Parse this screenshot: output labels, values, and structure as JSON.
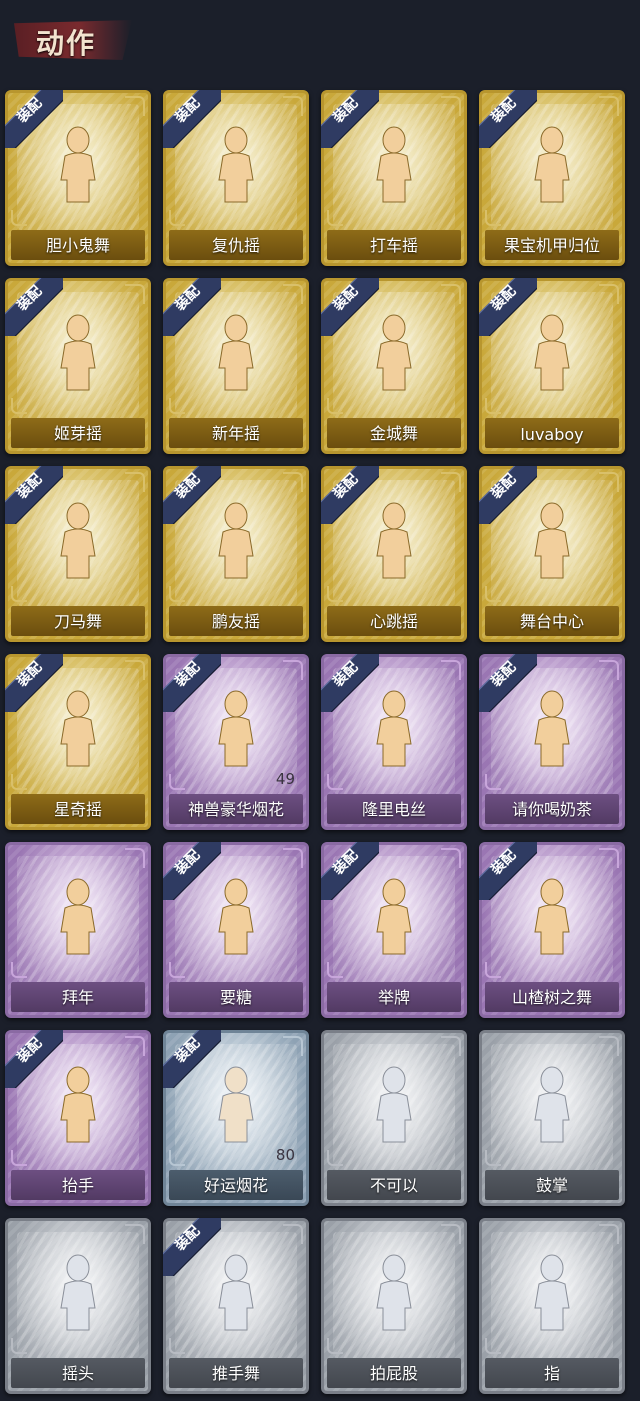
{
  "header": {
    "title": "动作"
  },
  "equip_label": "装配",
  "icons": [
    "figure-icon"
  ],
  "colors": {
    "gold": "#c9a83a",
    "purple": "#9a76b3",
    "blue": "#8ea2b4",
    "gray": "#9aa0a8",
    "equip_badge": "#2f3b62"
  },
  "cards": [
    {
      "name": "胆小鬼舞",
      "rarity": "gold",
      "equipped": true
    },
    {
      "name": "复仇摇",
      "rarity": "gold",
      "equipped": true
    },
    {
      "name": "打车摇",
      "rarity": "gold",
      "equipped": true
    },
    {
      "name": "果宝机甲归位",
      "rarity": "gold",
      "equipped": true
    },
    {
      "name": "姬芽摇",
      "rarity": "gold",
      "equipped": true
    },
    {
      "name": "新年摇",
      "rarity": "gold",
      "equipped": true
    },
    {
      "name": "金城舞",
      "rarity": "gold",
      "equipped": true
    },
    {
      "name": "luvaboy",
      "rarity": "gold",
      "equipped": true
    },
    {
      "name": "刀马舞",
      "rarity": "gold",
      "equipped": true
    },
    {
      "name": "鹏友摇",
      "rarity": "gold",
      "equipped": true
    },
    {
      "name": "心跳摇",
      "rarity": "gold",
      "equipped": true
    },
    {
      "name": "舞台中心",
      "rarity": "gold",
      "equipped": true
    },
    {
      "name": "星奇摇",
      "rarity": "gold",
      "equipped": true
    },
    {
      "name": "神兽豪华烟花",
      "rarity": "purple",
      "equipped": true,
      "count": "49"
    },
    {
      "name": "隆里电丝",
      "rarity": "purple",
      "equipped": true
    },
    {
      "name": "请你喝奶茶",
      "rarity": "purple",
      "equipped": true
    },
    {
      "name": "拜年",
      "rarity": "purple",
      "equipped": false
    },
    {
      "name": "要糖",
      "rarity": "purple",
      "equipped": true
    },
    {
      "name": "举牌",
      "rarity": "purple",
      "equipped": true
    },
    {
      "name": "山楂树之舞",
      "rarity": "purple",
      "equipped": true
    },
    {
      "name": "抬手",
      "rarity": "purple",
      "equipped": true
    },
    {
      "name": "好运烟花",
      "rarity": "blue",
      "equipped": true,
      "count": "80"
    },
    {
      "name": "不可以",
      "rarity": "gray",
      "equipped": false
    },
    {
      "name": "鼓掌",
      "rarity": "gray",
      "equipped": false
    },
    {
      "name": "摇头",
      "rarity": "gray",
      "equipped": false
    },
    {
      "name": "推手舞",
      "rarity": "gray",
      "equipped": true
    },
    {
      "name": "拍屁股",
      "rarity": "gray",
      "equipped": false
    },
    {
      "name": "指",
      "rarity": "gray",
      "equipped": false
    }
  ]
}
